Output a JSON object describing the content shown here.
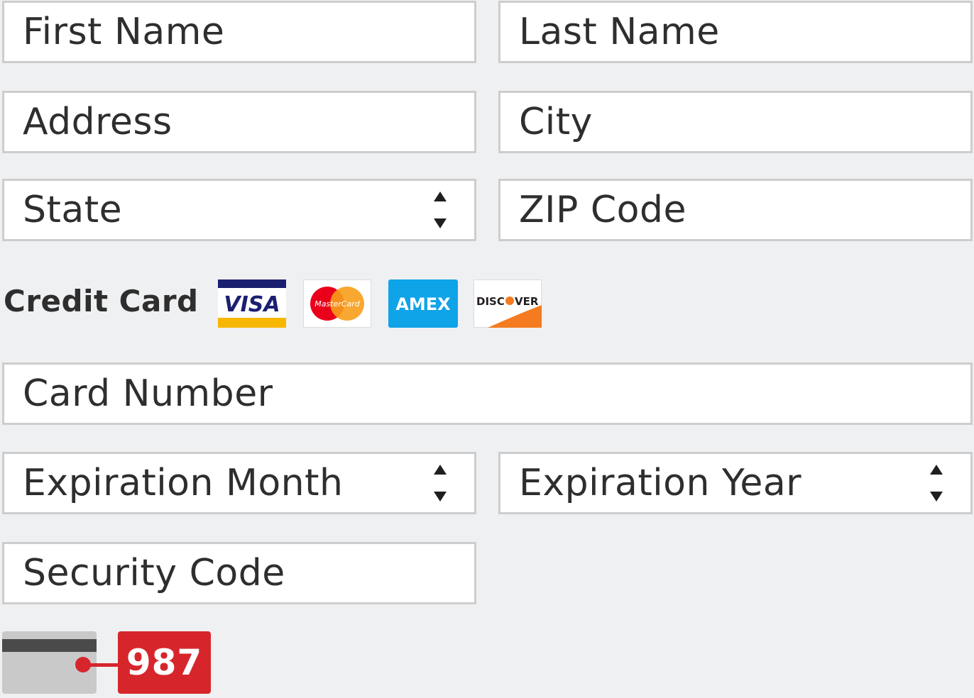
{
  "form": {
    "first_name": {
      "placeholder": "First Name"
    },
    "last_name": {
      "placeholder": "Last Name"
    },
    "address": {
      "placeholder": "Address"
    },
    "city": {
      "placeholder": "City"
    },
    "state": {
      "selected": "State"
    },
    "zip": {
      "placeholder": "ZIP Code"
    },
    "credit_card_label": "Credit Card",
    "card_logos": [
      {
        "name": "VISA",
        "icon": "visa-logo-icon"
      },
      {
        "name": "MasterCard",
        "icon": "mastercard-logo-icon"
      },
      {
        "name": "AMEX",
        "icon": "amex-logo-icon"
      },
      {
        "name": "DISCOVER",
        "icon": "discover-logo-icon"
      }
    ],
    "card_number": {
      "placeholder": "Card Number"
    },
    "exp_month": {
      "selected": "Expiration Month"
    },
    "exp_year": {
      "selected": "Expiration Year"
    },
    "security_code": {
      "placeholder": "Security Code"
    },
    "cvv_hint": {
      "code": "987",
      "icon": "card-back-icon"
    }
  },
  "colors": {
    "background": "#eff0f1",
    "field_border": "#cdcdcd",
    "accent_red": "#d6262c",
    "visa_blue": "#1a1f71",
    "amex_blue": "#0fa3e8",
    "discover_orange": "#f47b20"
  }
}
